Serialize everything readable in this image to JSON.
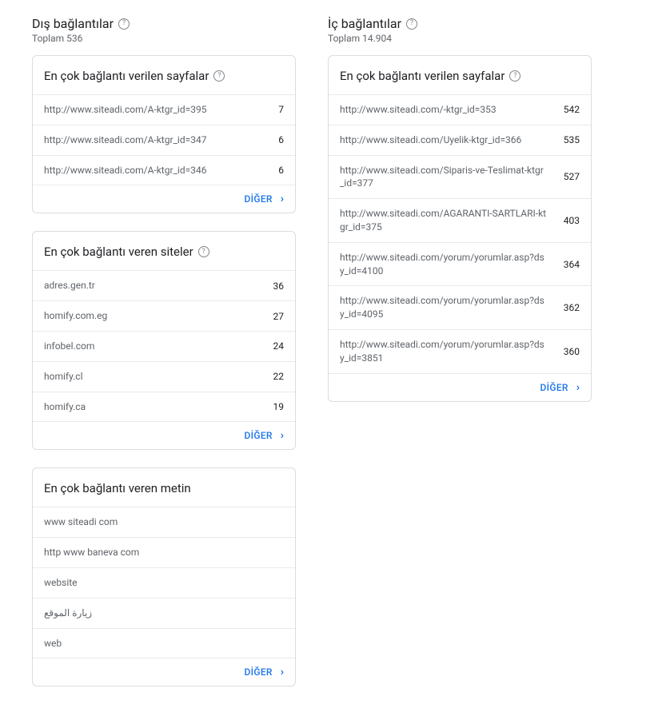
{
  "labels": {
    "more": "DİĞER"
  },
  "left": {
    "title": "Dış bağlantılar",
    "subtitle": "Toplam 536",
    "cards": {
      "topPages": {
        "title": "En çok bağlantı verilen sayfalar",
        "rows": [
          {
            "label": "http://www.siteadi.com/A-ktgr_id=395",
            "value": "7"
          },
          {
            "label": "http://www.siteadi.com/A-ktgr_id=347",
            "value": "6"
          },
          {
            "label": "http://www.siteadi.com/A-ktgr_id=346",
            "value": "6"
          }
        ]
      },
      "topSites": {
        "title": "En çok bağlantı veren siteler",
        "rows": [
          {
            "label": "adres.gen.tr",
            "value": "36"
          },
          {
            "label": "homify.com.eg",
            "value": "27"
          },
          {
            "label": "infobel.com",
            "value": "24"
          },
          {
            "label": "homify.cl",
            "value": "22"
          },
          {
            "label": "homify.ca",
            "value": "19"
          }
        ]
      },
      "topText": {
        "title": "En çok bağlantı veren metin",
        "rows": [
          {
            "label": "www siteadi com"
          },
          {
            "label": "http www baneva com"
          },
          {
            "label": "website"
          },
          {
            "label": "زيارة الموقع"
          },
          {
            "label": "web"
          }
        ]
      }
    }
  },
  "right": {
    "title": "İç bağlantılar",
    "subtitle": "Toplam 14.904",
    "cards": {
      "topPages": {
        "title": "En çok bağlantı verilen sayfalar",
        "rows": [
          {
            "label": "http://www.siteadi.com/-ktgr_id=353",
            "value": "542"
          },
          {
            "label": "http://www.siteadi.com/Uyelik-ktgr_id=366",
            "value": "535"
          },
          {
            "label": "http://www.siteadi.com/Siparis-ve-Teslimat-ktgr_id=377",
            "value": "527"
          },
          {
            "label": "http://www.siteadi.com/AGARANTI-SARTLARI-ktgr_id=375",
            "value": "403"
          },
          {
            "label": "http://www.siteadi.com/yorum/yorumlar.asp?dsy_id=4100",
            "value": "364"
          },
          {
            "label": "http://www.siteadi.com/yorum/yorumlar.asp?dsy_id=4095",
            "value": "362"
          },
          {
            "label": "http://www.siteadi.com/yorum/yorumlar.asp?dsy_id=3851",
            "value": "360"
          }
        ]
      }
    }
  }
}
